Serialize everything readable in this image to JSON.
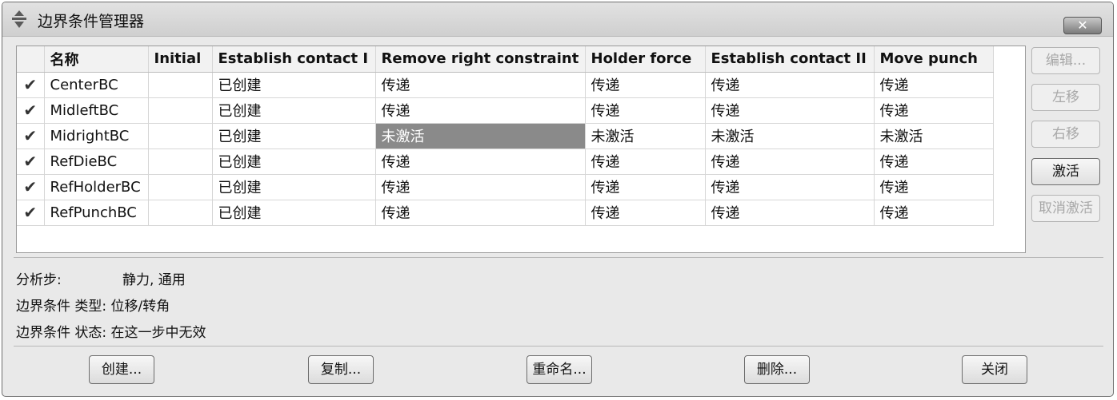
{
  "window": {
    "title": "边界条件管理器",
    "close_label": "✕"
  },
  "table": {
    "headers": [
      "名称",
      "Initial",
      "Establish contact I",
      "Remove right constraint",
      "Holder force",
      "Establish contact II",
      "Move punch"
    ],
    "rows": [
      {
        "check": "✔",
        "name": "CenterBC",
        "initial": "",
        "c1": "已创建",
        "c2": "传递",
        "c3": "传递",
        "c4": "传递",
        "c5": "传递"
      },
      {
        "check": "✔",
        "name": "MidleftBC",
        "initial": "",
        "c1": "已创建",
        "c2": "传递",
        "c3": "传递",
        "c4": "传递",
        "c5": "传递"
      },
      {
        "check": "✔",
        "name": "MidrightBC",
        "initial": "",
        "c1": "已创建",
        "c2": "未激活",
        "c3": "未激活",
        "c4": "未激活",
        "c5": "未激活"
      },
      {
        "check": "✔",
        "name": "RefDieBC",
        "initial": "",
        "c1": "已创建",
        "c2": "传递",
        "c3": "传递",
        "c4": "传递",
        "c5": "传递"
      },
      {
        "check": "✔",
        "name": "RefHolderBC",
        "initial": "",
        "c1": "已创建",
        "c2": "传递",
        "c3": "传递",
        "c4": "传递",
        "c5": "传递"
      },
      {
        "check": "✔",
        "name": "RefPunchBC",
        "initial": "",
        "c1": "已创建",
        "c2": "传递",
        "c3": "传递",
        "c4": "传递",
        "c5": "传递"
      }
    ]
  },
  "side_buttons": {
    "edit": "编辑...",
    "move_left": "左移",
    "move_right": "右移",
    "activate": "激活",
    "deactivate": "取消激活"
  },
  "info": {
    "step_label": "分析步:",
    "step_value": "静力, 通用",
    "type_label": "边界条件 类型:",
    "type_value": "位移/转角",
    "status_label": "边界条件 状态:",
    "status_value": "在这一步中无效"
  },
  "bottom_buttons": {
    "create": "创建...",
    "copy": "复制...",
    "rename": "重命名...",
    "delete": "删除...",
    "close": "关闭"
  }
}
